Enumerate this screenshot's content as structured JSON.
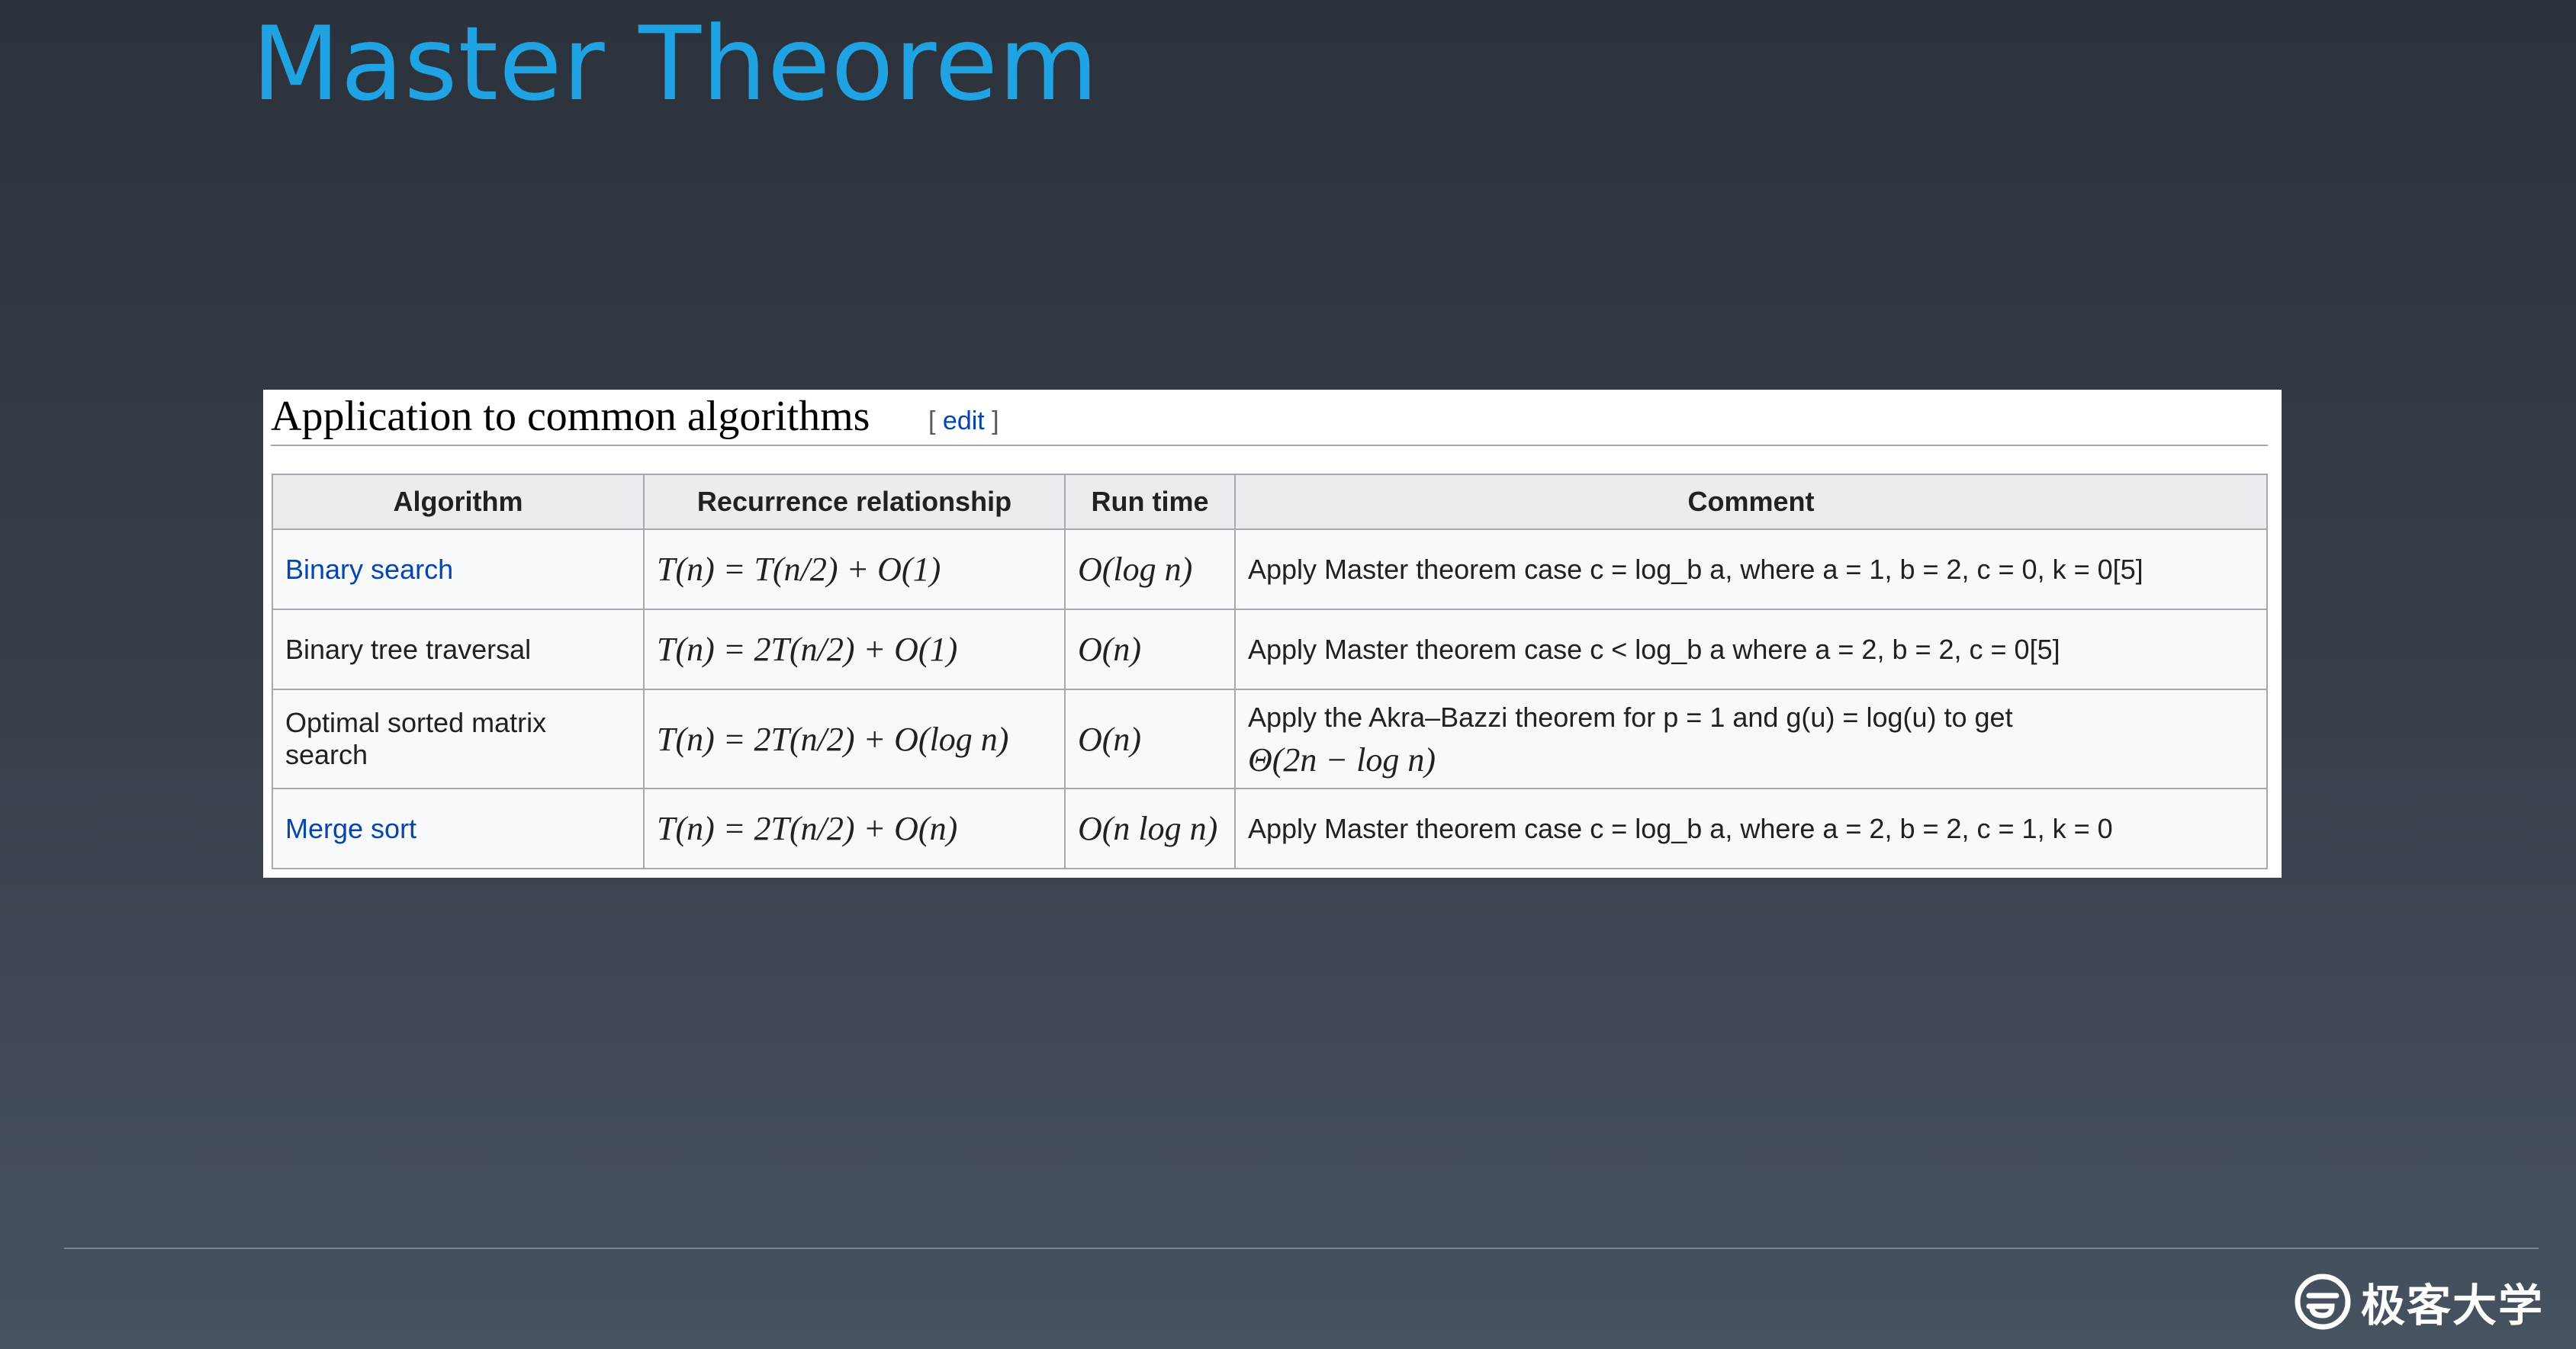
{
  "slide": {
    "title": "Master Theorem"
  },
  "section": {
    "heading": "Application to common algorithms",
    "edit_open": "[ ",
    "edit_label": "edit",
    "edit_close": " ]"
  },
  "table": {
    "headers": [
      "Algorithm",
      "Recurrence relationship",
      "Run time",
      "Comment"
    ],
    "rows": [
      {
        "algorithm": "Binary search",
        "recurrence": "T(n) = T(n/2) + O(1)",
        "runtime": "O(log n)",
        "comment": "Apply Master theorem case c = log_b a, where a = 1, b = 2, c = 0, k = 0[5]"
      },
      {
        "algorithm": "Binary tree traversal",
        "recurrence": "T(n) = 2T(n/2) + O(1)",
        "runtime": "O(n)",
        "comment": "Apply Master theorem case c < log_b a where a = 2, b = 2, c = 0[5]"
      },
      {
        "algorithm": "Optimal sorted matrix search",
        "recurrence": "T(n) = 2T(n/2) + O(log n)",
        "runtime": "O(n)",
        "comment_line1": "Apply the Akra–Bazzi theorem for p = 1 and g(u) = log(u) to get",
        "comment_line2": "Θ(2n − log n)"
      },
      {
        "algorithm": "Merge sort",
        "recurrence": "T(n) = 2T(n/2) + O(n)",
        "runtime": "O(n log n)",
        "comment": "Apply Master theorem case c = log_b a, where a = 2, b = 2, c = 1, k = 0"
      }
    ]
  },
  "brand": {
    "logo_icon": "geekbang-logo-icon",
    "name": "极客大学"
  },
  "colors": {
    "title": "#1fa3e3",
    "link": "#0645ad",
    "header_bg": "#eaecf0",
    "cell_bg": "#f8f9fa",
    "border": "#a2a9b1"
  }
}
